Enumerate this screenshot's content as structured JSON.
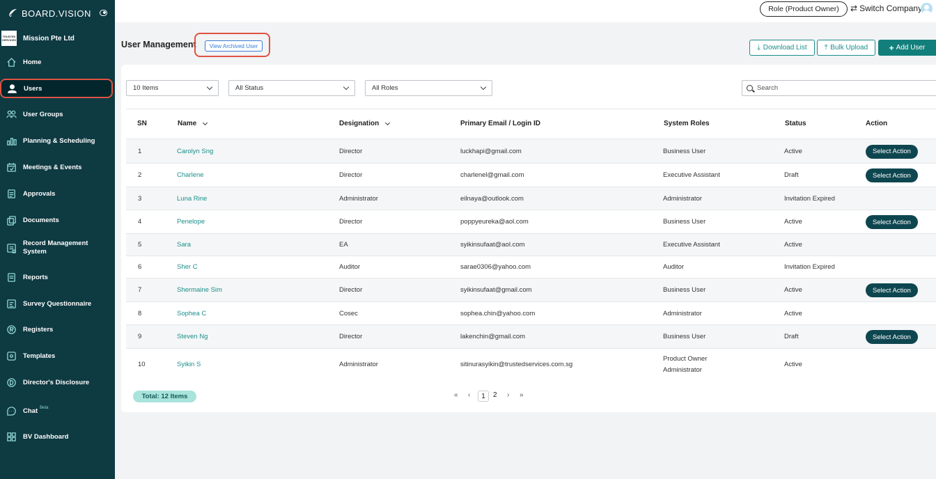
{
  "brand": {
    "name": "BOARD.VISION"
  },
  "org": {
    "name": "Mission Pte Ltd",
    "logo_text": "TRUSTED SERVICES"
  },
  "sidebar": {
    "items": [
      {
        "label": "Home",
        "icon": "home-icon"
      },
      {
        "label": "Users",
        "icon": "user-icon",
        "active": true
      },
      {
        "label": "User Groups",
        "icon": "users-icon"
      },
      {
        "label": "Planning & Scheduling",
        "icon": "bar-chart-icon"
      },
      {
        "label": "Meetings & Events",
        "icon": "calendar-icon"
      },
      {
        "label": "Approvals",
        "icon": "approval-icon"
      },
      {
        "label": "Documents",
        "icon": "documents-icon"
      },
      {
        "label": "Record Management System",
        "icon": "record-icon"
      },
      {
        "label": "Reports",
        "icon": "report-icon"
      },
      {
        "label": "Survey Questionnaire",
        "icon": "survey-icon"
      },
      {
        "label": "Registers",
        "icon": "registers-icon"
      },
      {
        "label": "Templates",
        "icon": "templates-icon"
      },
      {
        "label": "Director's Disclosure",
        "icon": "disclosure-icon"
      },
      {
        "label": "Chat",
        "icon": "chat-icon",
        "badge": "Beta"
      },
      {
        "label": "BV Dashboard",
        "icon": "dashboard-icon"
      }
    ]
  },
  "topbar": {
    "role_label": "Role (Product Owner)",
    "switch_label": "Switch Company"
  },
  "page": {
    "title": "User Management",
    "archived_label": "View Archived User",
    "download_label": "Download List",
    "bulk_label": "Bulk Upload",
    "add_label": "Add User"
  },
  "filters": {
    "items_value": "10 Items",
    "status_value": "All Status",
    "roles_value": "All Roles",
    "search_placeholder": "Search"
  },
  "table": {
    "columns": [
      "SN",
      "Name",
      "Designation",
      "Primary Email / Login ID",
      "System Roles",
      "Status",
      "Action"
    ],
    "rows": [
      {
        "sn": "1",
        "name": "Carolyn Sng",
        "designation": "Director",
        "email": "luckhapi@gmail.com",
        "roles": [
          "Business User"
        ],
        "status": "Active",
        "action": "Select Action"
      },
      {
        "sn": "2",
        "name": "Charlene",
        "designation": "Director",
        "email": "charlenel@gmail.com",
        "roles": [
          "Executive Assistant"
        ],
        "status": "Draft",
        "action": "Select Action"
      },
      {
        "sn": "3",
        "name": "Luna Rine",
        "designation": "Administrator",
        "email": "eilnaya@outlook.com",
        "roles": [
          "Administrator"
        ],
        "status": "Invitation Expired",
        "action": ""
      },
      {
        "sn": "4",
        "name": "Penelope",
        "designation": "Director",
        "email": "poppyeureka@aol.com",
        "roles": [
          "Business User"
        ],
        "status": "Active",
        "action": "Select Action"
      },
      {
        "sn": "5",
        "name": "Sara",
        "designation": "EA",
        "email": "syikinsufaat@aol.com",
        "roles": [
          "Executive Assistant"
        ],
        "status": "Active",
        "action": ""
      },
      {
        "sn": "6",
        "name": "Sher C",
        "designation": "Auditor",
        "email": "sarae0306@yahoo.com",
        "roles": [
          "Auditor"
        ],
        "status": "Invitation Expired",
        "action": ""
      },
      {
        "sn": "7",
        "name": "Shermaine Sim",
        "designation": "Director",
        "email": "syikinsufaat@gmail.com",
        "roles": [
          "Business User"
        ],
        "status": "Active",
        "action": "Select Action"
      },
      {
        "sn": "8",
        "name": "Sophea C",
        "designation": "Cosec",
        "email": "sophea.chin@yahoo.com",
        "roles": [
          "Administrator"
        ],
        "status": "Active",
        "action": ""
      },
      {
        "sn": "9",
        "name": "Steven Ng",
        "designation": "Director",
        "email": "lakenchin@gmail.com",
        "roles": [
          "Business User"
        ],
        "status": "Draft",
        "action": "Select Action"
      },
      {
        "sn": "10",
        "name": "Syikin S",
        "designation": "Administrator",
        "email": "sitinurasyikin@trustedservices.com.sg",
        "roles": [
          "Product Owner",
          "Administrator"
        ],
        "status": "Active",
        "action": ""
      }
    ]
  },
  "footer": {
    "total_label": "Total: 12 Items",
    "pages": [
      "1",
      "2"
    ],
    "current_page": "1"
  },
  "colors": {
    "sidebar_bg": "#0e3a42",
    "accent": "#137f7c",
    "highlight": "#e05242"
  }
}
